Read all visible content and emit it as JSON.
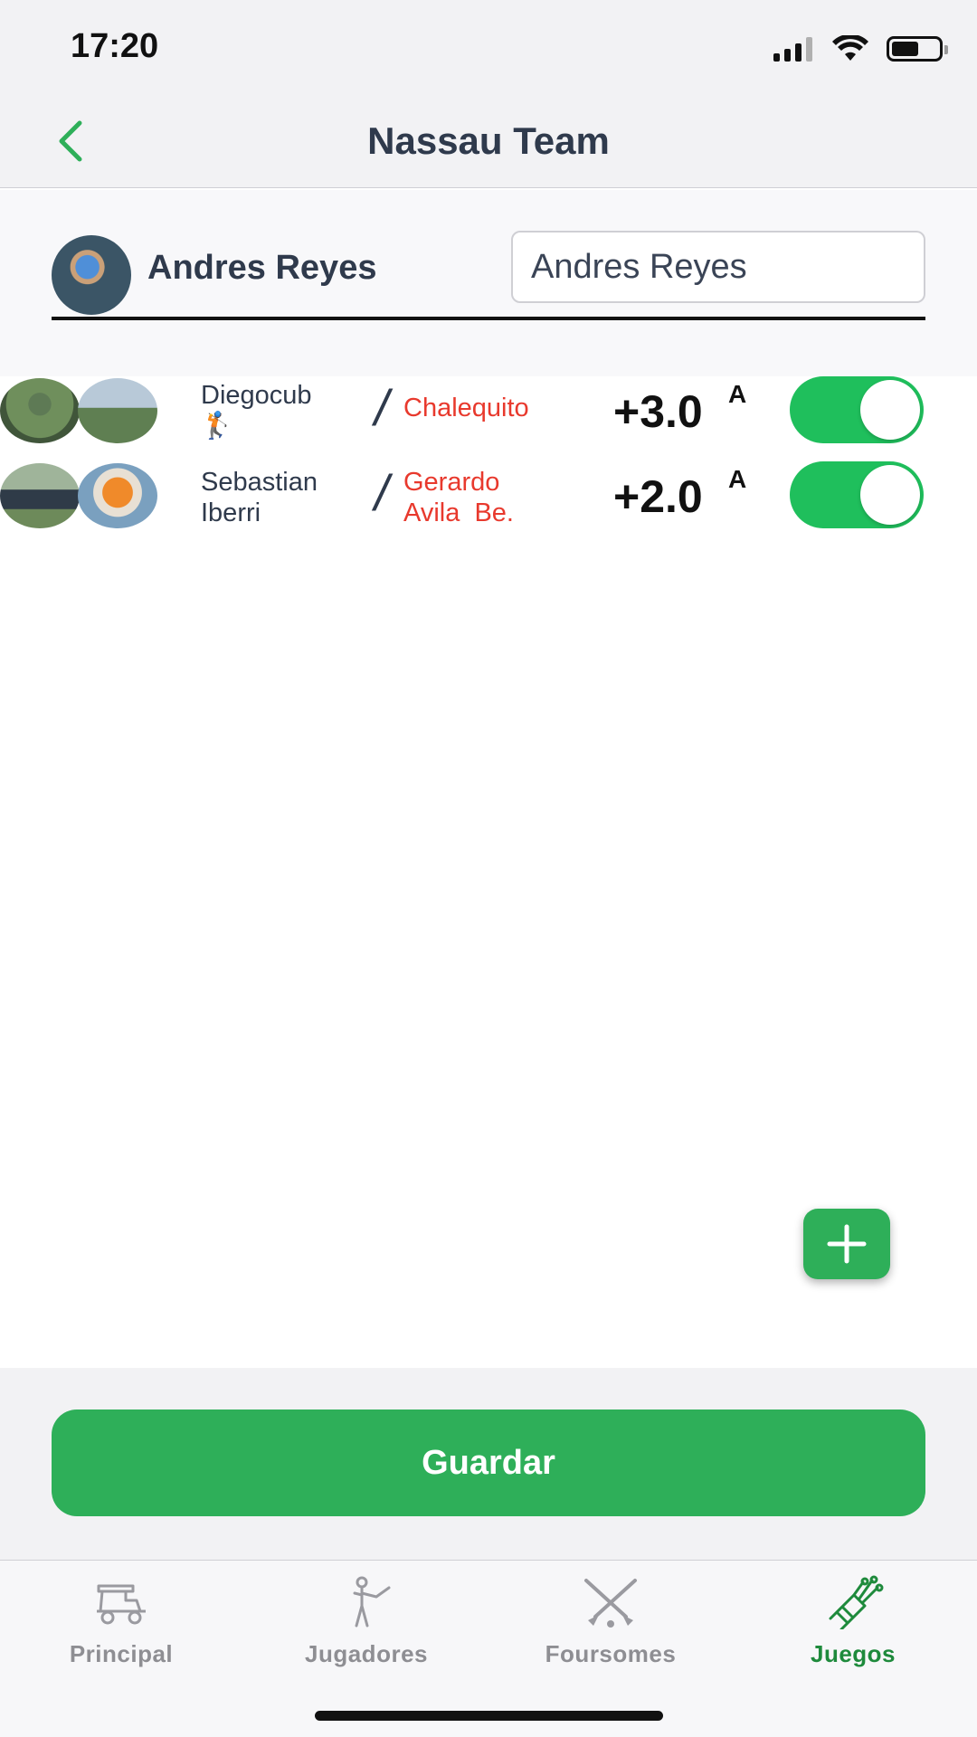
{
  "status": {
    "time": "17:20"
  },
  "nav": {
    "title": "Nassau Team"
  },
  "team": {
    "name": "Andres Reyes",
    "input_value": "Andres Reyes"
  },
  "pairs": [
    {
      "player1": "Diegocub\n🏌️",
      "player2": "Chalequito",
      "handicap": "+3.0",
      "handicap_mark": "A",
      "enabled": true
    },
    {
      "player1": "Sebastian\nIberri",
      "player2": "Gerardo\nAvila  Be.",
      "handicap": "+2.0",
      "handicap_mark": "A",
      "enabled": true
    }
  ],
  "actions": {
    "save_label": "Guardar",
    "add_icon": "plus-icon"
  },
  "tabs": [
    {
      "label": "Principal",
      "icon": "golf-cart-icon",
      "active": false
    },
    {
      "label": "Jugadores",
      "icon": "golfer-icon",
      "active": false
    },
    {
      "label": "Foursomes",
      "icon": "crossed-clubs-icon",
      "active": false
    },
    {
      "label": "Juegos",
      "icon": "golf-bag-icon",
      "active": true
    }
  ],
  "colors": {
    "accent": "#2eaf59",
    "toggle_on": "#1fbf5c",
    "partner_red": "#e8392d",
    "active_tab": "#1e8a3c",
    "inactive_tab": "#8e8e93"
  }
}
